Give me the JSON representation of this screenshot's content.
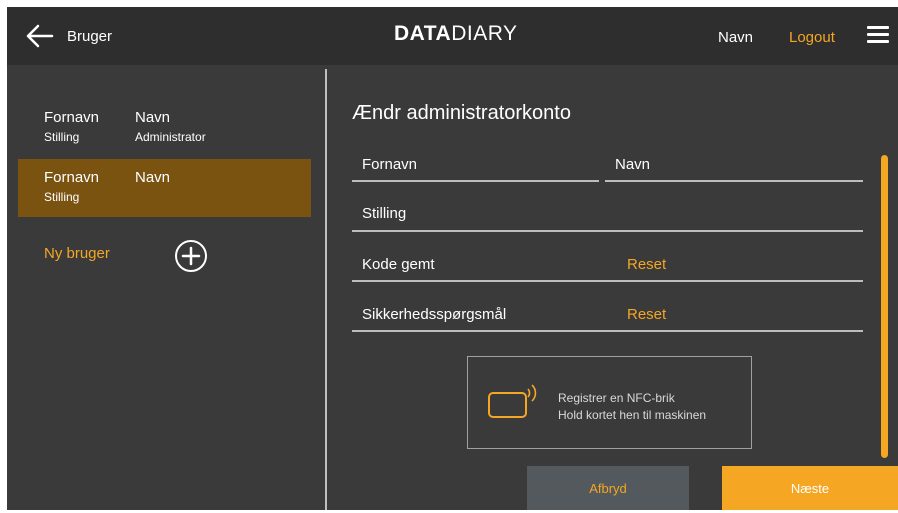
{
  "header": {
    "back_label": "Bruger",
    "brand_bold": "DATA",
    "brand_light": "DIARY",
    "user_name": "Navn",
    "logout_label": "Logout"
  },
  "sidebar": {
    "users": [
      {
        "first": "Fornavn",
        "last": "Navn",
        "title": "Stilling",
        "role": "Administrator",
        "active": false
      },
      {
        "first": "Fornavn",
        "last": "Navn",
        "title": "Stilling",
        "role": "",
        "active": true
      }
    ],
    "new_user_label": "Ny bruger"
  },
  "form": {
    "title": "Ændr administratorkonto",
    "first_name_label": "Fornavn",
    "last_name_label": "Navn",
    "title_label": "Stilling",
    "password_label": "Kode gemt",
    "security_label": "Sikkerhedsspørgsmål",
    "reset_label": "Reset"
  },
  "nfc": {
    "line1": "Registrer en NFC-brik",
    "line2": "Hold kortet hen til maskinen"
  },
  "buttons": {
    "cancel": "Afbryd",
    "next": "Næste"
  },
  "colors": {
    "accent": "#f5a623",
    "active_row": "#7a5310",
    "background": "#3a3a3a",
    "topbar": "#2e2e2e"
  },
  "icons": [
    "back-arrow-icon",
    "hamburger-menu-icon",
    "add-circle-icon",
    "nfc-card-icon"
  ]
}
